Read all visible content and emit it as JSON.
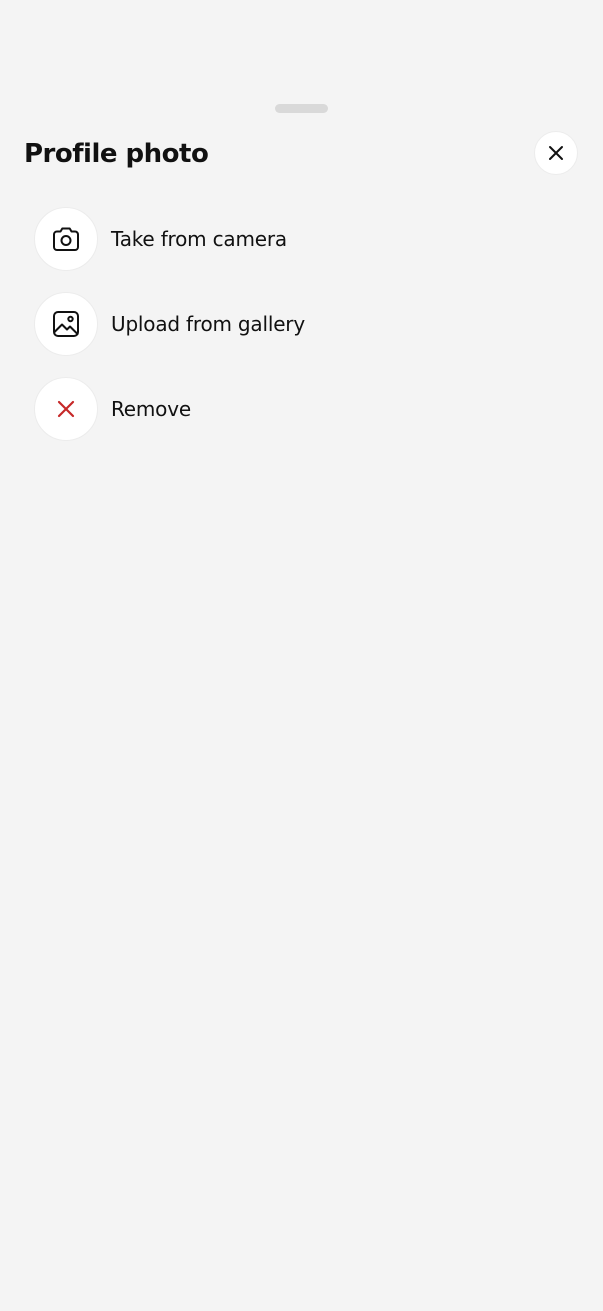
{
  "sheet": {
    "title": "Profile photo",
    "close_icon": "close-icon"
  },
  "options": [
    {
      "label": "Take from camera",
      "icon": "camera-icon"
    },
    {
      "label": "Upload from gallery",
      "icon": "gallery-image-icon"
    },
    {
      "label": "Remove",
      "icon": "remove-x-icon"
    }
  ],
  "colors": {
    "background": "#f4f4f4",
    "surface": "#ffffff",
    "text": "#111111",
    "handle": "#d9d9d9",
    "danger": "#c62828"
  }
}
